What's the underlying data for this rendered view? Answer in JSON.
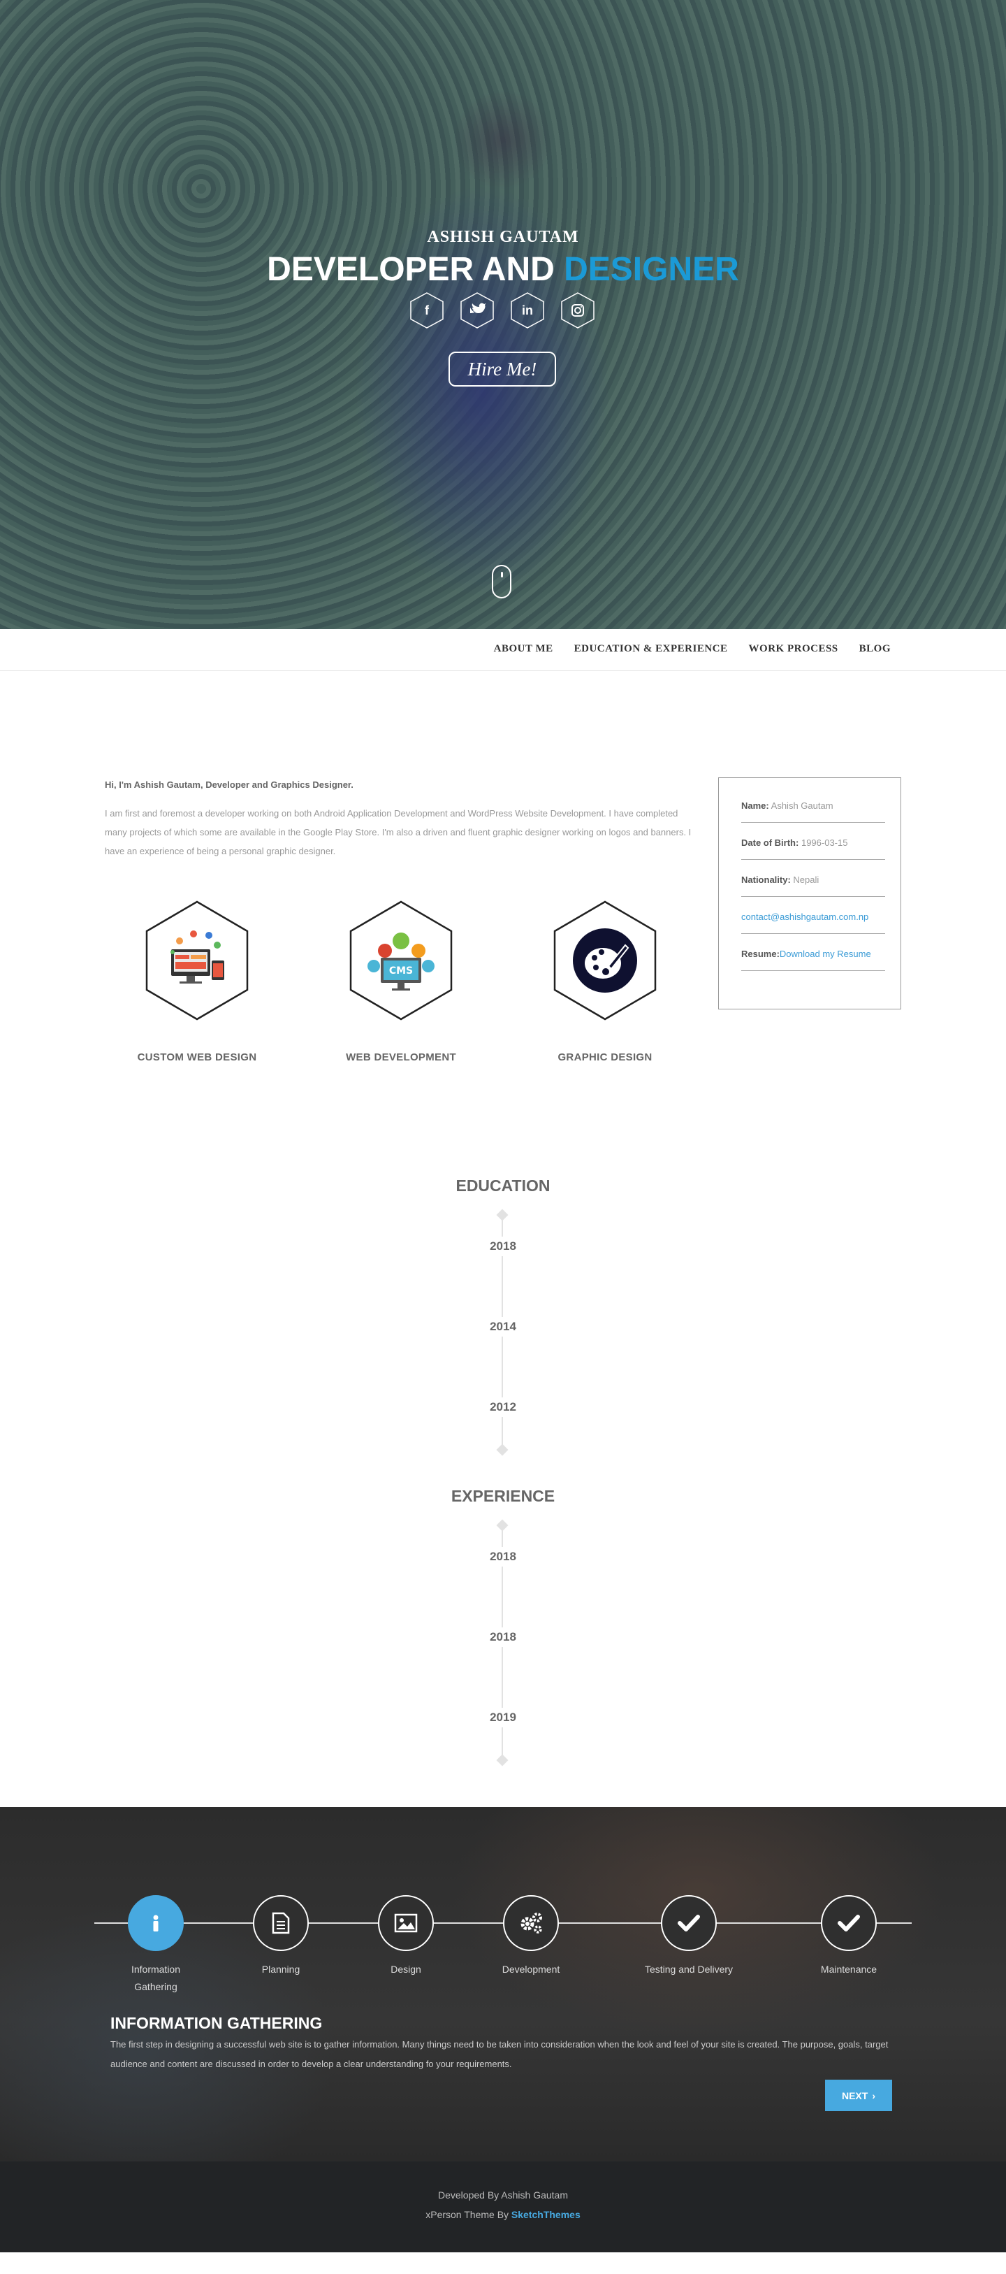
{
  "hero": {
    "name": "ASHISH GAUTAM",
    "title_main": "DEVELOPER AND ",
    "title_accent": "DESIGNER",
    "socials": [
      {
        "icon": "facebook-icon",
        "glyph": "f"
      },
      {
        "icon": "twitter-icon",
        "glyph": "t"
      },
      {
        "icon": "linkedin-icon",
        "glyph": "in"
      },
      {
        "icon": "instagram-icon",
        "glyph": "◎"
      }
    ],
    "hire_label": "Hire Me!",
    "accent_color": "#1b9ad6"
  },
  "nav": {
    "items": [
      "ABOUT ME",
      "EDUCATION & EXPERIENCE",
      "WORK PROCESS",
      "BLOG"
    ]
  },
  "about": {
    "heading": "Hi, I'm Ashish Gautam, Developer and Graphics Designer.",
    "text": "I am first and foremost a developer working on both Android Application Development and WordPress Website Development. I have completed many projects of which some are available in the Google Play Store. I'm also a driven and fluent graphic designer working on logos and banners. I have an experience of being a personal graphic designer.",
    "info": {
      "name_label": "Name:",
      "name": "Ashish Gautam",
      "dob_label": "Date of Birth:",
      "dob": "1996-03-15",
      "nationality_label": "Nationality:",
      "nationality": "Nepali",
      "email": "contact@ashishgautam.com.np",
      "resume_label": "Resume:",
      "resume_link": "Download my Resume"
    },
    "services": [
      "CUSTOM WEB DESIGN",
      "WEB DEVELOPMENT",
      "GRAPHIC DESIGN"
    ]
  },
  "education": {
    "title": "EDUCATION",
    "years": [
      "2018",
      "2014",
      "2012"
    ]
  },
  "experience": {
    "title": "EXPERIENCE",
    "years": [
      "2018",
      "2018",
      "2019"
    ]
  },
  "process": {
    "steps": [
      {
        "label": "Information Gathering",
        "icon": "info-icon"
      },
      {
        "label": "Planning",
        "icon": "document-icon"
      },
      {
        "label": "Design",
        "icon": "image-icon"
      },
      {
        "label": "Development",
        "icon": "gears-icon"
      },
      {
        "label": "Testing and Delivery",
        "icon": "check-icon"
      },
      {
        "label": "Maintenance",
        "icon": "check-icon"
      }
    ],
    "active_title": "INFORMATION GATHERING",
    "active_text": "The first step in designing a successful web site is to gather information. Many things need to be taken into consideration when the look and feel of your site is created. The purpose, goals, target audience and content are discussed in order to develop a clear understanding fo your requirements.",
    "next_label": "NEXT",
    "accent_color": "#47a9e0"
  },
  "footer": {
    "line1": "Developed By Ashish Gautam",
    "line2_prefix": "xPerson Theme By ",
    "line2_link": "SketchThemes"
  }
}
